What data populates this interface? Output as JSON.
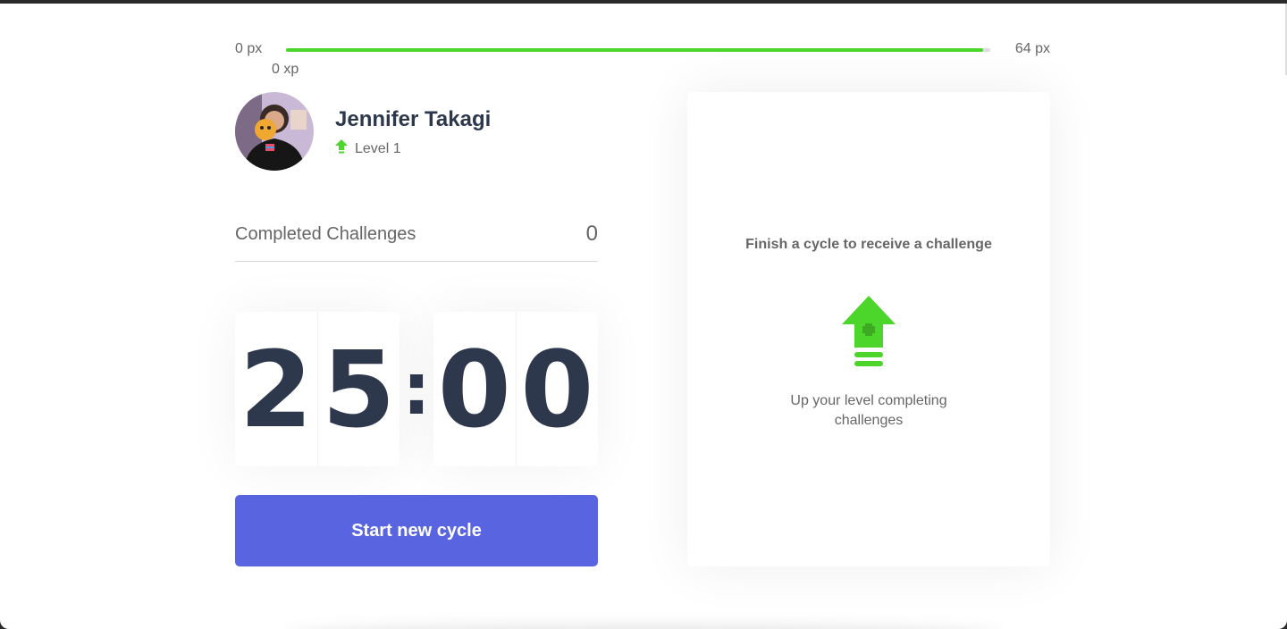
{
  "xp_bar": {
    "min_label": "0 px",
    "max_label": "64 px",
    "current_label": "0 xp",
    "progress_fraction": 0.99,
    "fill_color": "#4cd62b"
  },
  "profile": {
    "name": "Jennifer Takagi",
    "level_label": "Level 1",
    "level_icon": "level-up-arrow-icon",
    "avatar_alt": "avatar"
  },
  "completed_challenges": {
    "label": "Completed Challenges",
    "count": "0"
  },
  "countdown": {
    "minute_tens": "2",
    "minute_ones": "5",
    "separator": ":",
    "second_tens": "0",
    "second_ones": "0"
  },
  "start_button": {
    "label": "Start new cycle",
    "color": "#5965e0"
  },
  "challenge_box": {
    "title": "Finish a cycle to receive a challenge",
    "icon": "level-up-icon",
    "hint": "Up your level completing challenges"
  },
  "colors": {
    "accent_green": "#4cd62b",
    "title_text": "#2e384d",
    "body_text": "#666666"
  }
}
